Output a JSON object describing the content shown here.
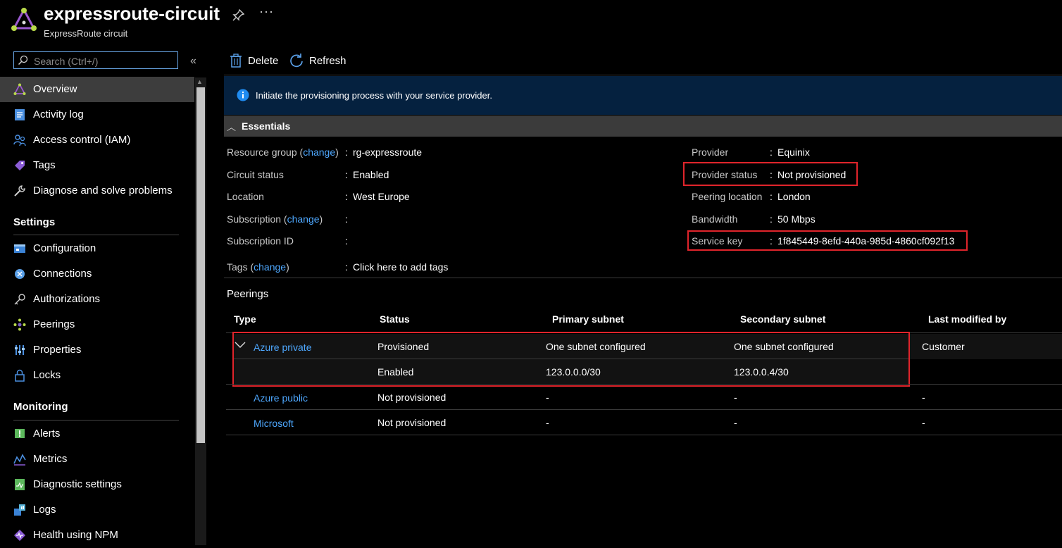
{
  "header": {
    "title": "expressroute-circuit",
    "subtitle": "ExpressRoute circuit",
    "more": "···"
  },
  "sidebar": {
    "search_placeholder": "Search (Ctrl+/)",
    "collapse": "«",
    "items": [
      {
        "label": "Overview",
        "icon": "expressroute-icon"
      },
      {
        "label": "Activity log",
        "icon": "activity-log-icon"
      },
      {
        "label": "Access control (IAM)",
        "icon": "iam-icon"
      },
      {
        "label": "Tags",
        "icon": "tag-icon"
      },
      {
        "label": "Diagnose and solve problems",
        "icon": "wrench-icon"
      }
    ],
    "settings_heading": "Settings",
    "settings": [
      {
        "label": "Configuration",
        "icon": "configuration-icon"
      },
      {
        "label": "Connections",
        "icon": "connections-icon"
      },
      {
        "label": "Authorizations",
        "icon": "key-icon"
      },
      {
        "label": "Peerings",
        "icon": "peerings-icon"
      },
      {
        "label": "Properties",
        "icon": "properties-icon"
      },
      {
        "label": "Locks",
        "icon": "lock-icon"
      }
    ],
    "monitoring_heading": "Monitoring",
    "monitoring": [
      {
        "label": "Alerts",
        "icon": "alerts-icon"
      },
      {
        "label": "Metrics",
        "icon": "metrics-icon"
      },
      {
        "label": "Diagnostic settings",
        "icon": "diagnostic-settings-icon"
      },
      {
        "label": "Logs",
        "icon": "logs-icon"
      },
      {
        "label": "Health using NPM",
        "icon": "health-icon"
      }
    ]
  },
  "toolbar": {
    "delete_label": "Delete",
    "refresh_label": "Refresh"
  },
  "banner": {
    "text": "Initiate the provisioning process with your service provider."
  },
  "essentials": {
    "label": "Essentials",
    "resource_group_key": "Resource group",
    "change_link": "change",
    "resource_group_value": "rg-expressroute",
    "circuit_status_key": "Circuit status",
    "circuit_status_value": "Enabled",
    "location_key": "Location",
    "location_value": "West Europe",
    "subscription_key": "Subscription",
    "subscription_value": "",
    "subscription_id_key": "Subscription ID",
    "subscription_id_value": "",
    "tags_key": "Tags",
    "tags_value": "Click here to add tags",
    "provider_key": "Provider",
    "provider_value": "Equinix",
    "provider_status_key": "Provider status",
    "provider_status_value": "Not provisioned",
    "peering_location_key": "Peering location",
    "peering_location_value": "London",
    "bandwidth_key": "Bandwidth",
    "bandwidth_value": "50 Mbps",
    "service_key_key": "Service key",
    "service_key_value": "1f845449-8efd-440a-985d-4860cf092f13"
  },
  "peerings": {
    "title": "Peerings",
    "columns": [
      "Type",
      "Status",
      "Primary subnet",
      "Secondary subnet",
      "Last modified by"
    ],
    "rows": [
      {
        "type": "Azure private",
        "status": "Provisioned",
        "primary": "One subnet configured",
        "secondary": "One subnet configured",
        "modified": "Customer"
      },
      {
        "type": "",
        "status": "Enabled",
        "primary": "123.0.0.0/30",
        "secondary": "123.0.0.4/30",
        "modified": ""
      },
      {
        "type": "Azure public",
        "status": "Not provisioned",
        "primary": "-",
        "secondary": "-",
        "modified": "-"
      },
      {
        "type": "Microsoft",
        "status": "Not provisioned",
        "primary": "-",
        "secondary": "-",
        "modified": "-"
      }
    ]
  }
}
